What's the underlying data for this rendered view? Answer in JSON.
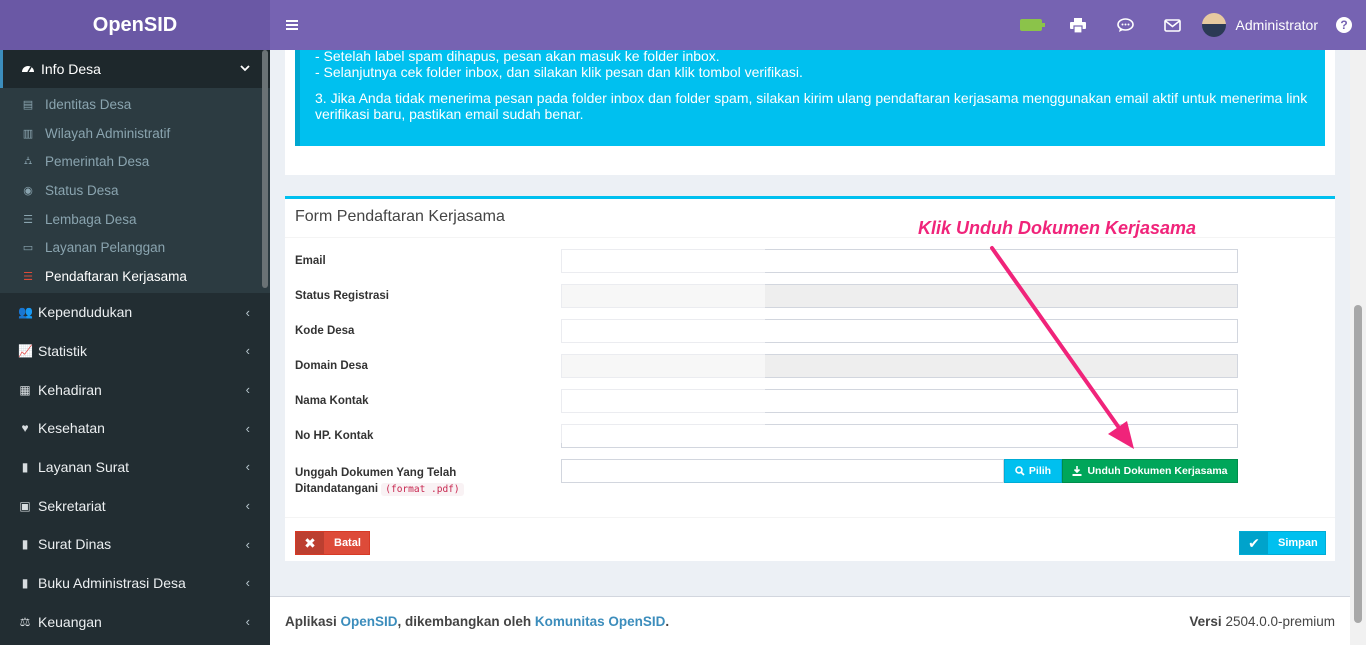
{
  "app": {
    "title": "OpenSID"
  },
  "header": {
    "user": "Administrator",
    "help_label": "?"
  },
  "sidebar": {
    "active_group": "Info Desa",
    "sub_items": [
      {
        "label": "Identitas Desa",
        "icon": "id-card-icon"
      },
      {
        "label": "Wilayah Administratif",
        "icon": "map-icon"
      },
      {
        "label": "Pemerintah Desa",
        "icon": "sitemap-icon"
      },
      {
        "label": "Status Desa",
        "icon": "dot-circle-icon"
      },
      {
        "label": "Lembaga Desa",
        "icon": "list-icon"
      },
      {
        "label": "Layanan Pelanggan",
        "icon": "credit-card-icon"
      },
      {
        "label": "Pendaftaran Kerjasama",
        "icon": "list-red-icon"
      }
    ],
    "items": [
      {
        "label": "Kependudukan"
      },
      {
        "label": "Statistik"
      },
      {
        "label": "Kehadiran"
      },
      {
        "label": "Kesehatan"
      },
      {
        "label": "Layanan Surat"
      },
      {
        "label": "Sekretariat"
      },
      {
        "label": "Surat Dinas"
      },
      {
        "label": "Buku Administrasi Desa"
      },
      {
        "label": "Keuangan"
      }
    ]
  },
  "info": {
    "line1": "- Setelah label spam dihapus, pesan akan masuk ke folder inbox.",
    "line2": "- Selanjutnya cek folder inbox, dan silakan klik pesan dan klik tombol verifikasi.",
    "line3": "3. Jika Anda tidak menerima pesan pada folder inbox dan folder spam, silakan kirim ulang pendaftaran kerjasama menggunakan email aktif untuk menerima link verifikasi baru, pastikan email sudah benar."
  },
  "form": {
    "title": "Form Pendaftaran Kerjasama",
    "email_label": "Email",
    "status_label": "Status Registrasi",
    "kode_label": "Kode Desa",
    "domain_label": "Domain Desa",
    "kontak_label": "Nama Kontak",
    "hp_label": "No HP. Kontak",
    "upload_label_line1": "Unggah Dokumen Yang Telah",
    "upload_label_line2": "Ditandatangani",
    "upload_format": "(format .pdf)",
    "pilih_label": "Pilih",
    "unduh_label": "Unduh Dokumen Kerjasama",
    "batal_label": "Batal",
    "simpan_label": "Simpan"
  },
  "annotation": {
    "text": "Klik Unduh Dokumen Kerjasama",
    "color": "#f0247a"
  },
  "footer": {
    "prefix": "Aplikasi ",
    "app_link": "OpenSID",
    "middle": ", dikembangkan oleh ",
    "community_link": "Komunitas OpenSID",
    "suffix": ".",
    "version_label": "Versi",
    "version": "2504.0.0-premium"
  }
}
